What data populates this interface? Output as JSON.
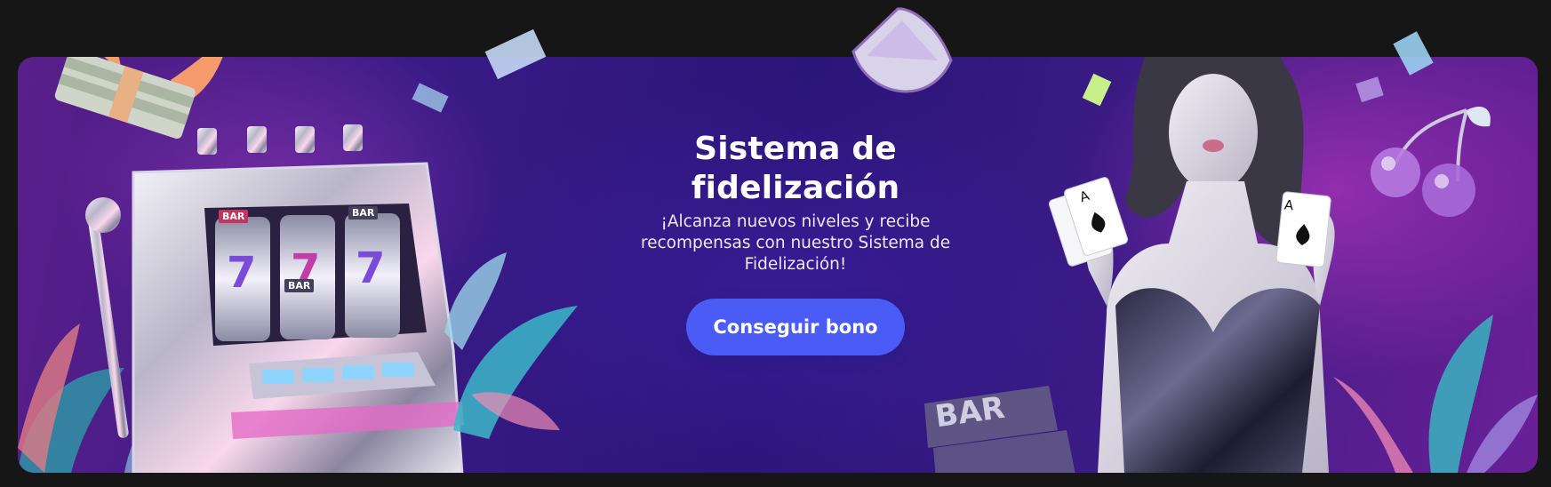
{
  "promo": {
    "title_line1": "Sistema de",
    "title_line2": "fidelización",
    "subtitle": "¡Alcanza nuevos niveles y recibe recompensas con nuestro Sistema de Fidelización!",
    "button_label": "Conseguir bono"
  },
  "slot_machine": {
    "reel_symbols": [
      "7",
      "7",
      "7"
    ],
    "reel_labels": [
      "BAR",
      "BAR",
      "BAR"
    ]
  },
  "bar_logo": {
    "label": "BAR"
  },
  "playing_cards": {
    "rank": "A"
  },
  "colors": {
    "page_background": "#161616",
    "banner_purple": "#2a1578",
    "button_blue": "#4a5cf5",
    "text_white": "#ffffff"
  },
  "icons": [
    "winged-money-stack-icon",
    "slot-machine-icon",
    "lemon-slice-icon",
    "cherries-icon",
    "playing-card-icon",
    "confetti-icon",
    "leaf-icon",
    "bar-symbol-icon"
  ]
}
